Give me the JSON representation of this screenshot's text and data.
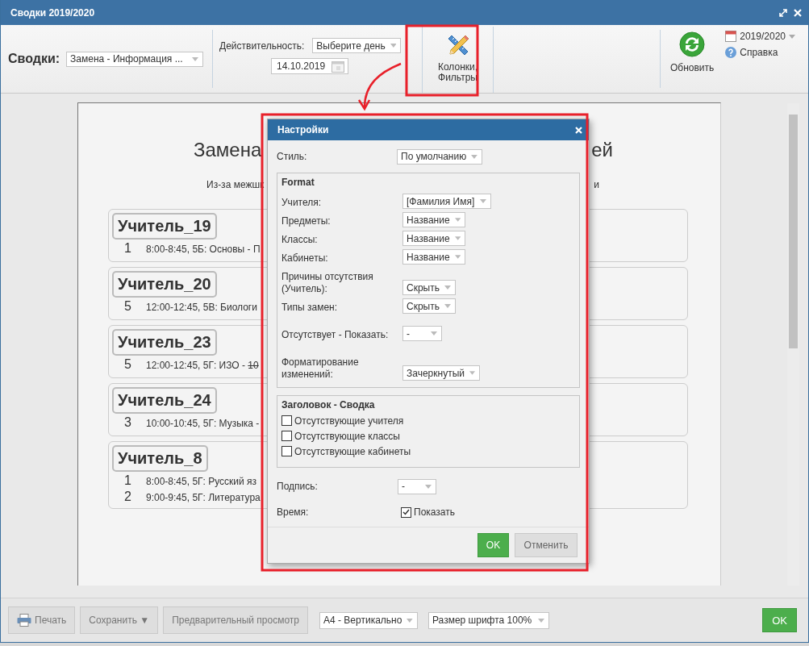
{
  "window": {
    "title": "Сводки 2019/2020"
  },
  "toolbar": {
    "reports_label": "Сводки:",
    "report_select": "Замена - Информация ...",
    "validity_label": "Действительность:",
    "day_select": "Выберите день",
    "date": "14.10.2019",
    "columns_button": [
      "Колонки,",
      "Фильтры"
    ],
    "refresh_button": "Обновить",
    "year": "2019/2020",
    "help": "Справка"
  },
  "document": {
    "title_parts": [
      "Замена",
      "ей"
    ],
    "subtitle_parts": [
      "Из-за межшк",
      "и"
    ],
    "cards": [
      {
        "name": "Учитель_19",
        "lines": [
          {
            "period": "1",
            "text": "8:00-8:45, 5Б: Основы - П"
          }
        ]
      },
      {
        "name": "Учитель_20",
        "lines": [
          {
            "period": "5",
            "text": "12:00-12:45, 5В: Биологи"
          }
        ]
      },
      {
        "name": "Учитель_23",
        "lines": [
          {
            "period": "5",
            "text": "12:00-12:45, 5Г: ИЗО - ",
            "struck": "10"
          }
        ]
      },
      {
        "name": "Учитель_24",
        "lines": [
          {
            "period": "3",
            "text": "10:00-10:45, 5Г: Музыка -"
          }
        ]
      },
      {
        "name": "Учитель_8",
        "lines": [
          {
            "period": "1",
            "text": "8:00-8:45, 5Г: Русский яз"
          },
          {
            "period": "2",
            "text": "9:00-9:45, 5Г: Литература"
          }
        ]
      }
    ]
  },
  "dialog": {
    "title": "Настройки",
    "style_label": "Стиль:",
    "style_value": "По умолчанию",
    "format_group": {
      "title": "Format",
      "rows": [
        {
          "label": "Учителя:",
          "value": "[Фамилия Имя]"
        },
        {
          "label": "Предметы:",
          "value": "Название"
        },
        {
          "label": "Классы:",
          "value": "Название"
        },
        {
          "label": "Кабинеты:",
          "value": "Название"
        },
        {
          "label": "Причины отсутствия (Учитель):",
          "value": "Скрыть"
        },
        {
          "label": "Типы замен:",
          "value": "Скрыть"
        },
        {
          "label": "Отсутствует - Показать:",
          "value": "-"
        },
        {
          "label": "Форматирование изменений:",
          "value": "Зачеркнутый"
        }
      ]
    },
    "header_group": {
      "title": "Заголовок - Сводка",
      "options": [
        {
          "label": "Отсутствующие учителя",
          "checked": false
        },
        {
          "label": "Отсутствующие классы",
          "checked": false
        },
        {
          "label": "Отсутствующие кабинеты",
          "checked": false
        }
      ]
    },
    "signature_label": "Подпись:",
    "signature_value": "-",
    "time_label": "Время:",
    "time_option": {
      "label": "Показать",
      "checked": true
    },
    "ok": "OK",
    "cancel": "Отменить"
  },
  "bottom_bar": {
    "print": "Печать",
    "save": "Сохранить ▼",
    "preview": "Предварительный просмотр",
    "page_format": "A4 - Вертикально",
    "font_size": "Размер шрифта 100%",
    "ok": "OK"
  }
}
